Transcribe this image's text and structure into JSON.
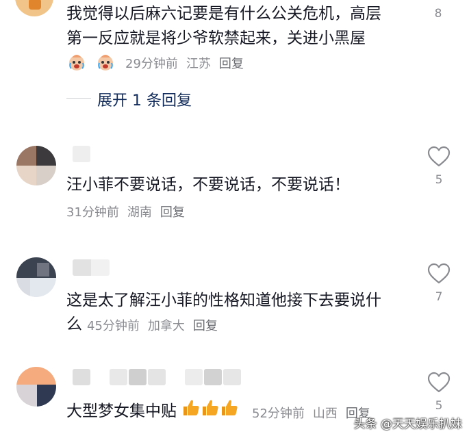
{
  "comments": [
    {
      "text_lines": [
        "我觉得以后麻六记要是有什么公关危机，高层",
        "第一反应就是将少爷软禁起来，关进小黑屋"
      ],
      "time": "29分钟前",
      "location": "江苏",
      "reply_label": "回复",
      "likes": "8",
      "emojis": [
        "crying-laughing-emoji",
        "crying-laughing-emoji"
      ],
      "expand_label": "展开 1 条回复"
    },
    {
      "text_lines": [
        "汪小菲不要说话，不要说话，不要说话！"
      ],
      "time": "31分钟前",
      "location": "湖南",
      "reply_label": "回复",
      "likes": "5"
    },
    {
      "text_lines": [
        "这是太了解汪小菲的性格知道他接下去要说什",
        "么"
      ],
      "time": "45分钟前",
      "location": "加拿大",
      "reply_label": "回复",
      "likes": "7"
    },
    {
      "text_lines": [
        "大型梦女集中贴"
      ],
      "emojis": [
        "thumbs-up-emoji",
        "thumbs-up-emoji",
        "thumbs-up-emoji"
      ],
      "time": "52分钟前",
      "location": "山西",
      "reply_label": "回复",
      "likes": "5"
    }
  ],
  "watermark": "头条 @天天娱乐扒妹",
  "colors": {
    "text": "#161823",
    "meta": "#8a8b91",
    "expand": "#0f2a5a",
    "thumb": "#f5a623"
  }
}
